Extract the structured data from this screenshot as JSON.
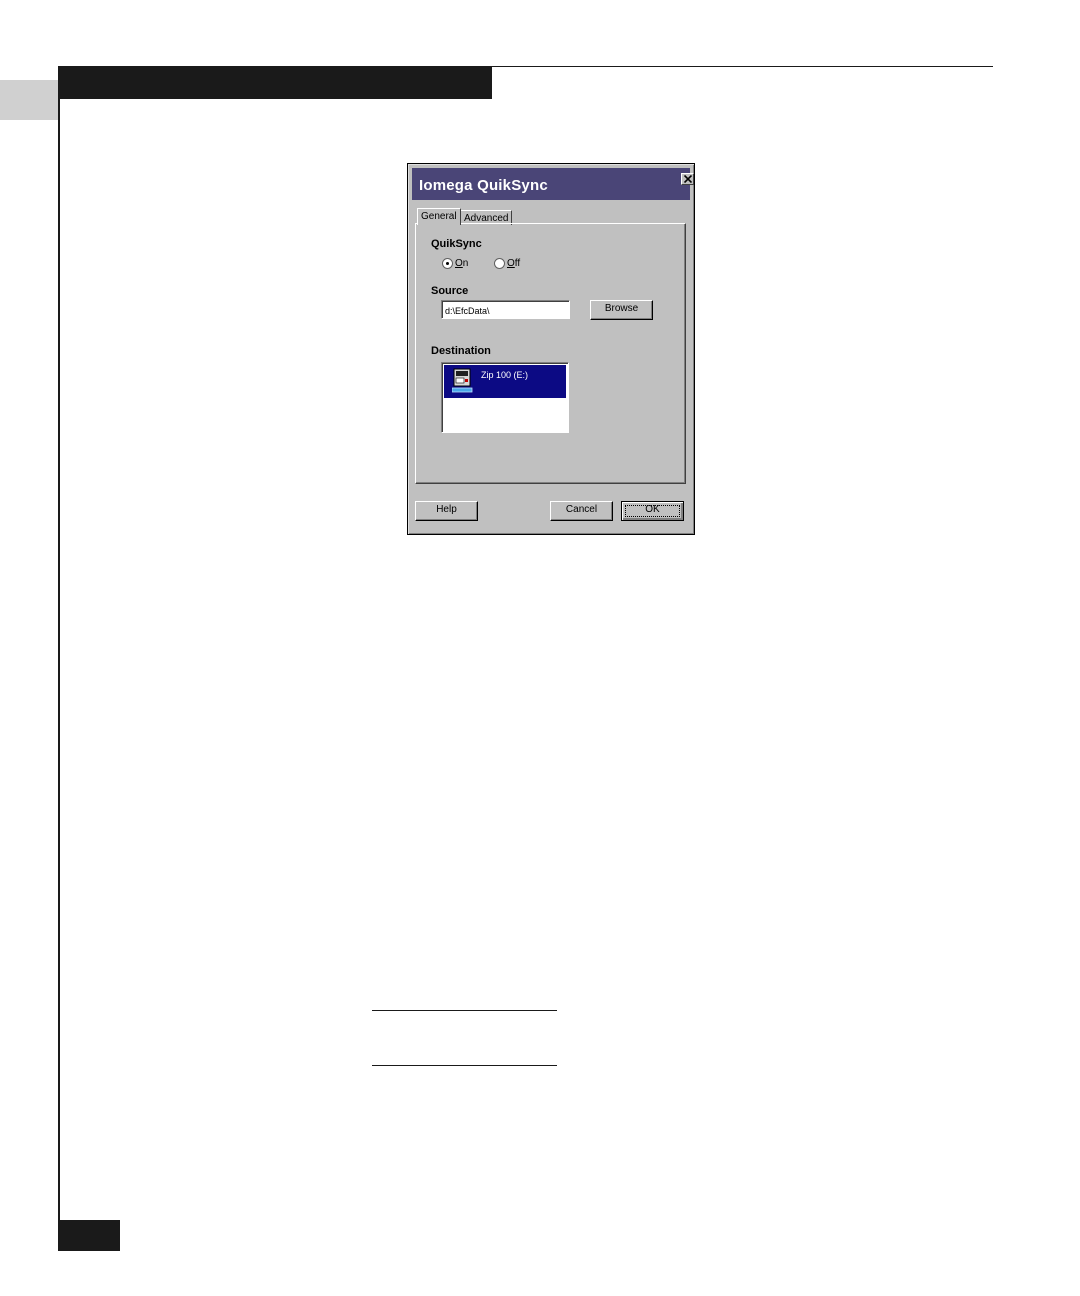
{
  "dialog": {
    "title": "Iomega QuikSync",
    "tabs": [
      {
        "label": "General",
        "active": true
      },
      {
        "label": "Advanced",
        "active": false
      }
    ],
    "quiksync": {
      "group_label": "QuikSync",
      "options": [
        {
          "label": "On",
          "selected": true
        },
        {
          "label": "Off",
          "selected": false
        }
      ]
    },
    "source": {
      "group_label": "Source",
      "value": "d:\\EfcData\\",
      "browse_label": "Browse"
    },
    "destination": {
      "group_label": "Destination",
      "items": [
        {
          "label": "Zip 100 (E:)",
          "icon": "zip-drive-icon",
          "selected": true
        }
      ]
    },
    "buttons": {
      "help": "Help",
      "cancel": "Cancel",
      "ok": "OK"
    },
    "colors": {
      "titlebar": "#4a4577",
      "selection": "#0c0a84",
      "face": "#c0c0c0"
    }
  }
}
